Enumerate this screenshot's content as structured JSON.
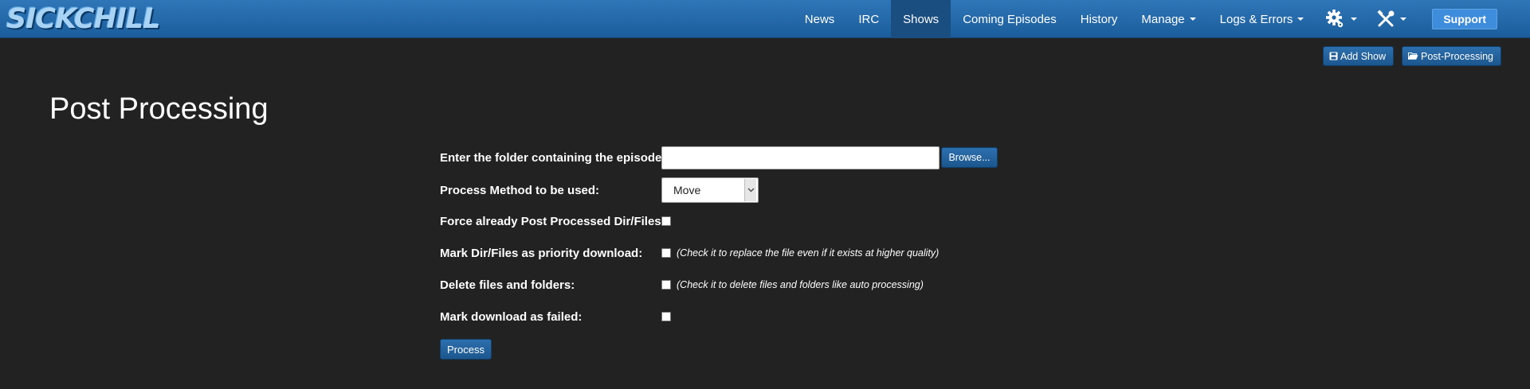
{
  "app": {
    "logo_text": "SICKCHILL"
  },
  "nav": {
    "items": [
      {
        "label": "News"
      },
      {
        "label": "IRC"
      },
      {
        "label": "Shows",
        "active": true
      },
      {
        "label": "Coming Episodes"
      },
      {
        "label": "History"
      },
      {
        "label": "Manage",
        "dropdown": true
      },
      {
        "label": "Logs & Errors",
        "dropdown": true
      }
    ],
    "icons": [
      "gear-icon",
      "tools-icon"
    ],
    "support_label": "Support"
  },
  "toolbar": {
    "add_show_label": "Add Show",
    "post_processing_label": "Post-Processing"
  },
  "page": {
    "title": "Post Processing"
  },
  "form": {
    "folder_label": "Enter the folder containing the episode:",
    "folder_value": "",
    "browse_label": "Browse...",
    "method_label": "Process Method to be used:",
    "method_value": "Move",
    "force_label": "Force already Post Processed Dir/Files:",
    "priority_label": "Mark Dir/Files as priority download:",
    "priority_note": "(Check it to replace the file even if it exists at higher quality)",
    "delete_label": "Delete files and folders:",
    "delete_note": "(Check it to delete files and folders like auto processing)",
    "failed_label": "Mark download as failed:",
    "process_label": "Process"
  },
  "colors": {
    "navbar": "#2f76b8",
    "active_nav": "#1a4d80",
    "background": "#222222",
    "support_button": "#3e8cdc",
    "button": "#2d6fae"
  }
}
